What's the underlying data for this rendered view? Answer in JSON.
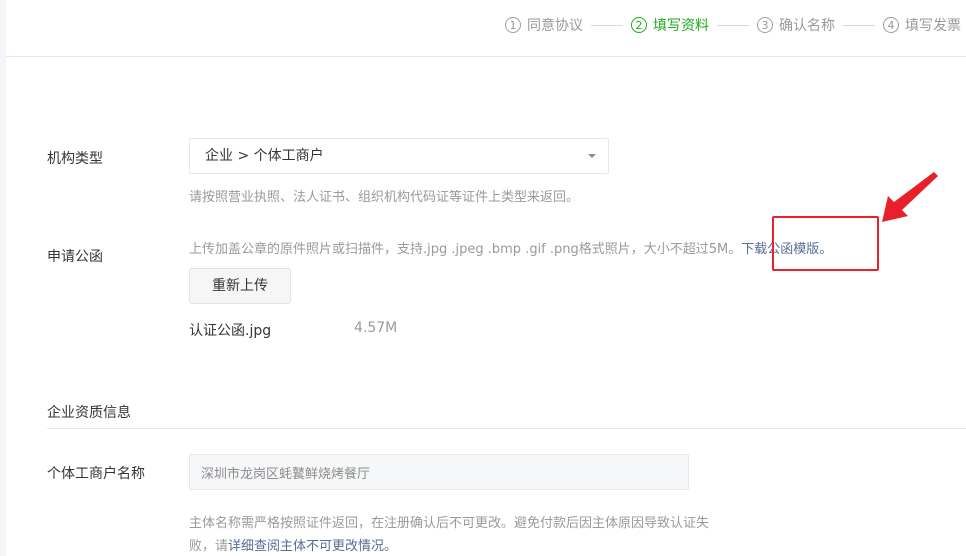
{
  "steps": [
    {
      "num": "1",
      "label": "同意协议",
      "active": false
    },
    {
      "num": "2",
      "label": "填写资料",
      "active": true
    },
    {
      "num": "3",
      "label": "确认名称",
      "active": false
    },
    {
      "num": "4",
      "label": "填写发票",
      "active": false
    }
  ],
  "org_type": {
    "label": "机构类型",
    "value": "企业 > 个体工商户",
    "hint": "请按照营业执照、法人证书、组织机构代码证等证件上类型来返回。"
  },
  "application_letter": {
    "label": "申请公函",
    "hint": "上传加盖公章的原件照片或扫描件，支持.jpg .jpeg .bmp .gif .png格式照片，大小不超过5M。",
    "download_link": "下载公函模版。",
    "reupload_button": "重新上传",
    "file_name": "认证公函.jpg",
    "file_size": "4.57M"
  },
  "section": {
    "title": "企业资质信息"
  },
  "business_name": {
    "label": "个体工商户名称",
    "value": "深圳市龙岗区蚝鼚鲜烧烤餐厅",
    "note_prefix": "主体名称需严格按照证件返回，在注册确认后不可更改。避免付款后因主体原因导致认证失败，请",
    "note_link": "详细查阅主体不可更改情况。"
  },
  "colors": {
    "accent_green": "#1aad19",
    "link_blue": "#576b95",
    "annotation_red": "#e8202a"
  }
}
